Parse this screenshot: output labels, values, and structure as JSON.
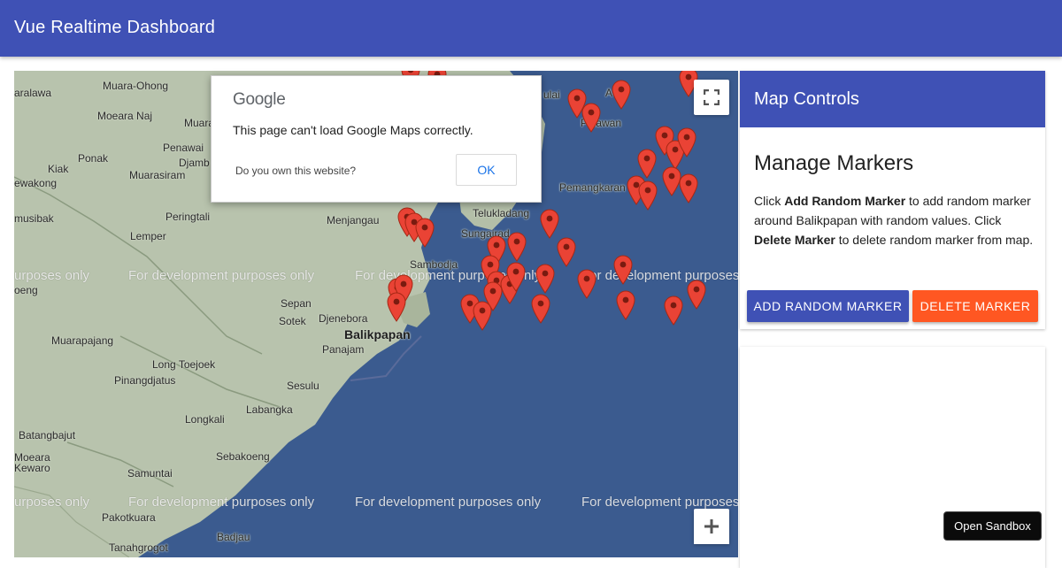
{
  "app": {
    "title": "Vue Realtime Dashboard"
  },
  "map": {
    "places": [
      {
        "name": "Muara-Ohong"
      },
      {
        "name": "Moeara Naj"
      },
      {
        "name": "Muarake"
      },
      {
        "name": "aralawa"
      },
      {
        "name": "Ponak"
      },
      {
        "name": "Penawai"
      },
      {
        "name": "Djamb"
      },
      {
        "name": "Kiak"
      },
      {
        "name": "Muarasiram"
      },
      {
        "name": "ewakong"
      },
      {
        "name": "musibak"
      },
      {
        "name": "Lemper"
      },
      {
        "name": "Peringtali"
      },
      {
        "name": "Menjangau"
      },
      {
        "name": "Sambodja"
      },
      {
        "name": "Telukladang"
      },
      {
        "name": "Sungairad"
      },
      {
        "name": "Pemangkaran"
      },
      {
        "name": "Balikpapan"
      },
      {
        "name": "Sepan"
      },
      {
        "name": "Djenebora"
      },
      {
        "name": "Sotek"
      },
      {
        "name": "Panajam"
      },
      {
        "name": "Muarapajang"
      },
      {
        "name": "Long Toejoek"
      },
      {
        "name": "Pinangdjatus"
      },
      {
        "name": "Sesulu"
      },
      {
        "name": "Labangka"
      },
      {
        "name": "Longkali"
      },
      {
        "name": "Batangbajut"
      },
      {
        "name": "Sebakoeng"
      },
      {
        "name": "Moeara"
      },
      {
        "name": "Kewaro"
      },
      {
        "name": "Samuntai"
      },
      {
        "name": "Pakotkuara"
      },
      {
        "name": "Badjau"
      },
      {
        "name": "Tanahgrogot"
      },
      {
        "name": "oeng"
      },
      {
        "name": "ulai"
      },
      {
        "name": "Pelawan"
      },
      {
        "name": "A"
      }
    ],
    "dev_watermark": "For development purposes only",
    "dev_watermark_left": "urposes only",
    "dev_watermark_right": "For development purposes",
    "icons": {
      "fullscreen": "fullscreen-icon",
      "zoom_in": "plus-icon",
      "pin": "map-pin-icon"
    },
    "pin_color": "#ea4335"
  },
  "error_dialog": {
    "logo": "Google",
    "message": "This page can't load Google Maps correctly.",
    "own_site": "Do you own this website?",
    "ok_label": "OK"
  },
  "controls": {
    "header": "Map Controls",
    "heading": "Manage Markers",
    "desc": {
      "p1": "Click ",
      "b1": "Add Random Marker",
      "p2": " to add random marker around Balikpapan with random values. Click ",
      "b2": "Delete Marker",
      "p3": " to delete random marker from map."
    },
    "add_label": "ADD RANDOM MARKER",
    "delete_label": "DELETE MARKER"
  },
  "sandbox_label": "Open Sandbox",
  "colors": {
    "primary": "#3f51b5",
    "accent": "#ff5722",
    "sea": "#3b5b8f",
    "land": "#b8c3ad"
  }
}
